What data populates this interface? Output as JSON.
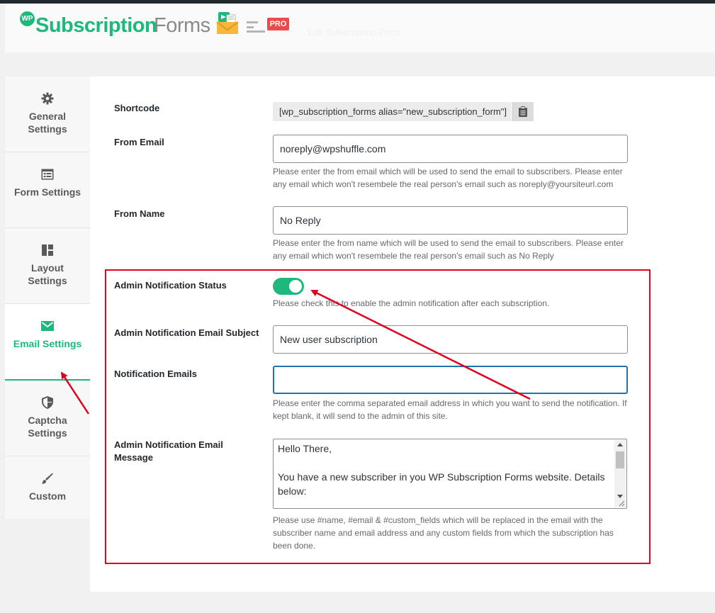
{
  "header": {
    "wp_badge": "WP",
    "brand_primary": "Subscription",
    "brand_secondary": "Forms",
    "pro_badge": "PRO",
    "faded_text": "Edit Subscription Form"
  },
  "sidebar": {
    "items": [
      {
        "label": "General Settings",
        "icon": "gear-icon",
        "active": false
      },
      {
        "label": "Form Settings",
        "icon": "form-icon",
        "active": false
      },
      {
        "label": "Layout Settings",
        "icon": "layout-icon",
        "active": false
      },
      {
        "label": "Email Settings",
        "icon": "envelope-icon",
        "active": true
      },
      {
        "label": "Captcha Settings",
        "icon": "shield-icon",
        "active": false
      },
      {
        "label": "Custom",
        "icon": "brush-icon",
        "active": false
      }
    ]
  },
  "form": {
    "shortcode": {
      "label": "Shortcode",
      "value": "[wp_subscription_forms alias=\"new_subscription_form\"]"
    },
    "from_email": {
      "label": "From Email",
      "value": "noreply@wpshuffle.com",
      "help": "Please enter the from email which will be used to send the email to subscribers. Please enter any email which won't resembele the real person's email such as noreply@yoursiteurl.com"
    },
    "from_name": {
      "label": "From Name",
      "value": "No Reply",
      "help": "Please enter the from name which will be used to send the email to subscribers. Please enter any email which won't resembele the real person's email such as No Reply"
    },
    "admin_notification_status": {
      "label": "Admin Notification Status",
      "enabled": true,
      "help": "Please check this to enable the admin notification after each subscription."
    },
    "admin_email_subject": {
      "label": "Admin Notification Email Subject",
      "value": "New user subscription"
    },
    "notification_emails": {
      "label": "Notification Emails",
      "value": "",
      "help": "Please enter the comma separated email address in which you want to send the notification. If kept blank, it will send to the admin of this site."
    },
    "admin_email_message": {
      "label": "Admin Notification Email Message",
      "value": "Hello There,\n\nYou have a new subscriber in you WP Subscription Forms website. Details below:",
      "help": "Please use #name, #email & #custom_fields which will be replaced in the email with the subscriber name and email address and any custom fields from which the subscription has been done."
    }
  },
  "colors": {
    "accent": "#1fb87c",
    "annotation": "#e0001b",
    "pro_badge": "#ef4a4a"
  }
}
